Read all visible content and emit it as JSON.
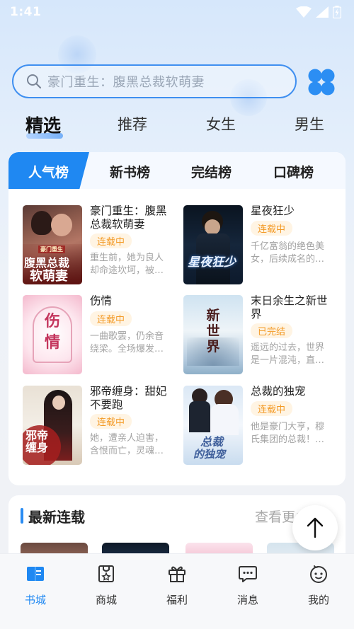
{
  "status_bar": {
    "time": "1:41"
  },
  "search": {
    "placeholder": "豪门重生：腹黑总裁软萌妻"
  },
  "top_tabs": [
    "精选",
    "推荐",
    "女生",
    "男生"
  ],
  "rank_tabs": [
    "人气榜",
    "新书榜",
    "完结榜",
    "口碑榜"
  ],
  "books": [
    {
      "title": "豪门重生：腹黑总裁软萌妻",
      "status": "连载中",
      "desc": "重生前，她为良人却命途坎坷，被…"
    },
    {
      "title": "星夜狂少",
      "status": "连载中",
      "desc": "千亿富翁的绝色美女，后续成名的…"
    },
    {
      "title": "伤情",
      "status": "连载中",
      "desc": "一曲歌罢，仍余音绕梁。全场爆发…"
    },
    {
      "title": "末日余生之新世界",
      "status": "已完结",
      "desc": "遥远的过去，世界是一片混沌，直…"
    },
    {
      "title": "邪帝缠身：甜妃不要跑",
      "status": "连载中",
      "desc": "她，遭亲人迫害，含恨而亡，灵魂…"
    },
    {
      "title": "总裁的独宠",
      "status": "连载中",
      "desc": "他是豪门大亨，穆氏集团的总裁！…"
    }
  ],
  "covers": {
    "c1": {
      "line1": "豪门重生",
      "line2": "腹黑总裁",
      "line3": "软萌妻"
    },
    "c2": {
      "text": "星夜狂少"
    },
    "c3": {
      "text": "伤情"
    },
    "c4": {
      "text": "新世界"
    },
    "c5": {
      "text": "邪帝缠身"
    },
    "c6": {
      "line1": "总裁",
      "line2": "的独宠"
    }
  },
  "latest": {
    "title": "最新连载",
    "more": "查看更多"
  },
  "bottom_nav": [
    "书城",
    "商城",
    "福利",
    "消息",
    "我的"
  ],
  "colors": {
    "accent": "#1f88f2",
    "status_orange": "#f39a26"
  }
}
